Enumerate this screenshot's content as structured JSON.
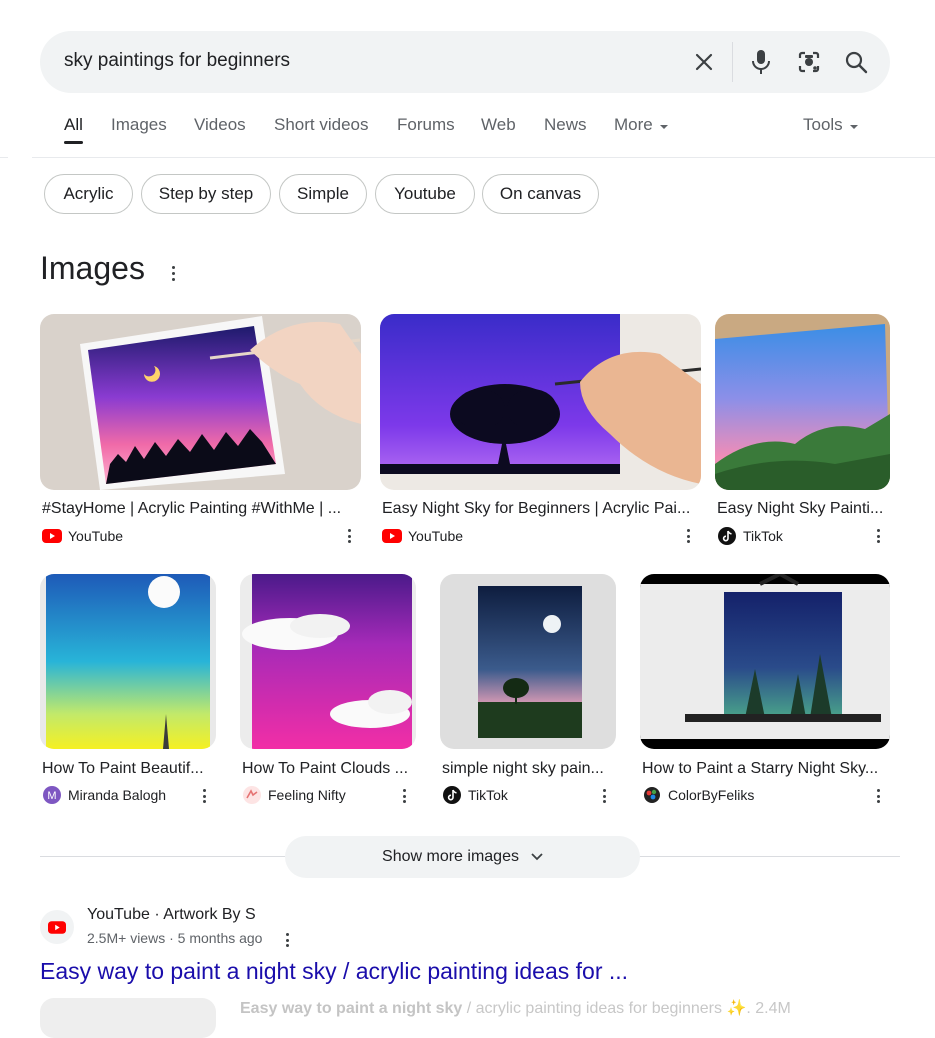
{
  "search": {
    "query": "sky paintings for beginners",
    "icons": [
      "close-icon",
      "microphone-icon",
      "lens-icon",
      "search-icon"
    ]
  },
  "tabs": [
    {
      "label": "All",
      "active": true
    },
    {
      "label": "Images"
    },
    {
      "label": "Videos"
    },
    {
      "label": "Short videos"
    },
    {
      "label": "Forums"
    },
    {
      "label": "Web"
    },
    {
      "label": "News"
    },
    {
      "label": "More"
    }
  ],
  "tools_label": "Tools",
  "chips": [
    "Acrylic",
    "Step by step",
    "Simple",
    "Youtube",
    "On canvas"
  ],
  "images_section": {
    "title": "Images",
    "row1": [
      {
        "title": "#StayHome | Acrylic Painting #WithMe | ...",
        "source": "YouTube",
        "source_icon": "youtube-icon"
      },
      {
        "title": "Easy Night Sky for Beginners | Acrylic Pai...",
        "source": "YouTube",
        "source_icon": "youtube-icon"
      },
      {
        "title": "Easy Night Sky Painti...",
        "source": "TikTok",
        "source_icon": "tiktok-icon"
      }
    ],
    "row2": [
      {
        "title": "How To Paint Beautif...",
        "source": "Miranda Balogh",
        "source_icon": "letter-m-icon"
      },
      {
        "title": "How To Paint Clouds ...",
        "source": "Feeling Nifty",
        "source_icon": "feeling-nifty-icon"
      },
      {
        "title": "simple night sky pain...",
        "source": "TikTok",
        "source_icon": "tiktok-icon"
      },
      {
        "title": "How to Paint a Starry Night Sky...",
        "source": "ColorByFeliks",
        "source_icon": "colorbyfeliks-icon"
      }
    ],
    "show_more": "Show more images"
  },
  "result": {
    "site": "YouTube · Artwork By S",
    "meta": "2.5M+ views · 5 months ago",
    "title": "Easy way to paint a night sky / acrylic painting ideas for ...",
    "snippet_bold": "Easy way to paint a night sky",
    "snippet_rest": " / acrylic painting ideas for beginners ✨. 2.4M"
  },
  "colors": {
    "link": "#1a0dab",
    "youtube_red": "#ff0000",
    "chip_border": "#c4c7c5",
    "search_bg": "#f1f3f4"
  }
}
